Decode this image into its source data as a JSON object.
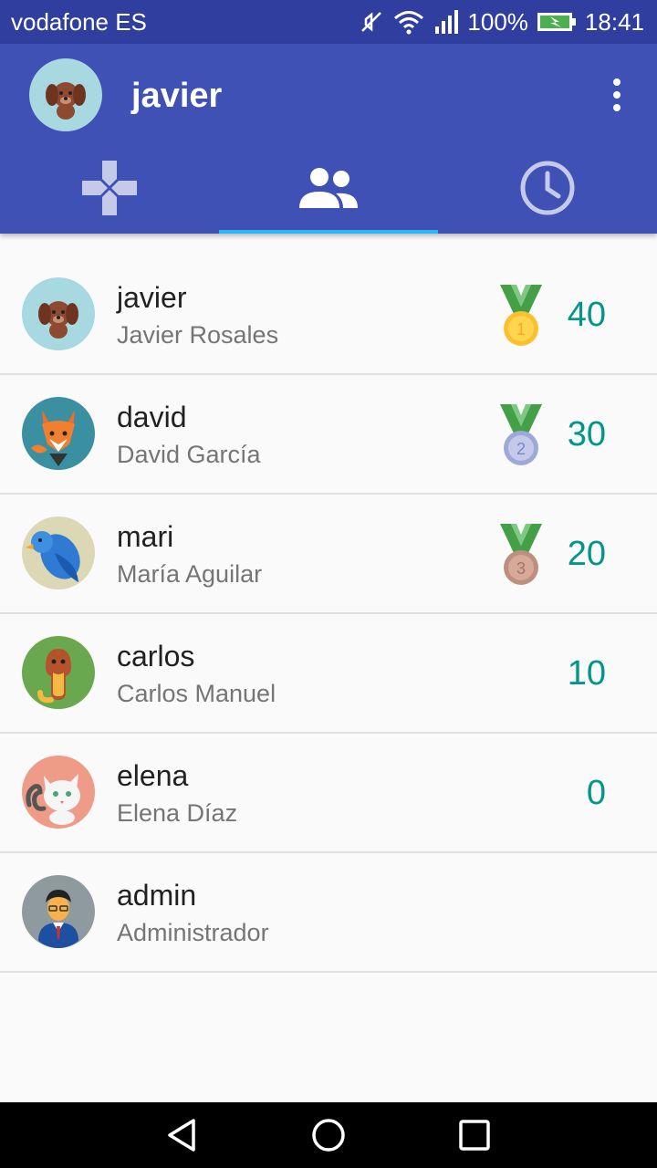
{
  "status_bar": {
    "carrier": "vodafone ES",
    "battery": "100%",
    "time": "18:41",
    "icons": [
      "mute-icon",
      "wifi-icon",
      "signal-icon",
      "battery-charging-icon"
    ]
  },
  "app_bar": {
    "title": "javier",
    "avatar": "dog-avatar",
    "menu_icon": "more-vert-icon"
  },
  "tabs": [
    {
      "name": "games",
      "icon": "gamepad-icon",
      "active": false
    },
    {
      "name": "users",
      "icon": "group-icon",
      "active": true
    },
    {
      "name": "history",
      "icon": "clock-icon",
      "active": false
    }
  ],
  "users": [
    {
      "username": "javier",
      "fullname": "Javier Rosales",
      "score": "40",
      "medal": "1",
      "avatar": "dog-avatar"
    },
    {
      "username": "david",
      "fullname": "David García",
      "score": "30",
      "medal": "2",
      "avatar": "fox-avatar"
    },
    {
      "username": "mari",
      "fullname": "María Aguilar",
      "score": "20",
      "medal": "3",
      "avatar": "bird-avatar"
    },
    {
      "username": "carlos",
      "fullname": "Carlos Manuel",
      "score": "10",
      "medal": "",
      "avatar": "snake-avatar"
    },
    {
      "username": "elena",
      "fullname": "Elena Díaz",
      "score": "0",
      "medal": "",
      "avatar": "cat-avatar"
    },
    {
      "username": "admin",
      "fullname": "Administrador",
      "score": "",
      "medal": "",
      "avatar": "admin-avatar"
    }
  ],
  "colors": {
    "primary": "#3f51b5",
    "primary_dark": "#303f9f",
    "accent": "#29b6f6",
    "score": "#009688",
    "gold": "#fbc02d",
    "silver": "#9fa8da",
    "bronze": "#bc8f7f"
  }
}
